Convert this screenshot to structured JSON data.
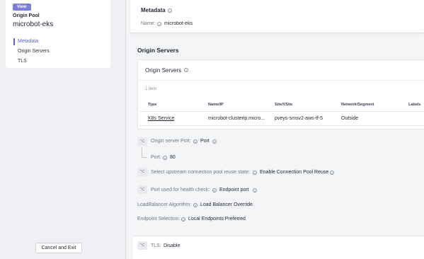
{
  "sidebar": {
    "badge": "View",
    "section_label": "Origin Pool",
    "pool_name": "microbot-eks",
    "items": [
      {
        "label": "Metadata",
        "active": true
      },
      {
        "label": "Origin Servers",
        "active": false
      },
      {
        "label": "TLS",
        "active": false
      }
    ],
    "cancel_label": "Cancel and Exit"
  },
  "metadata": {
    "title": "Metadata",
    "name_label": "Name:",
    "name_value": "microbot-eks"
  },
  "origin_servers": {
    "section_title": "Origin Servers",
    "card_title": "Origin Servers",
    "count": "1 item",
    "columns": [
      "Type",
      "Name/IP",
      "Site/VSite",
      "Network/Segment",
      "Labels"
    ],
    "rows": [
      [
        "K8s Service",
        "microbot-clusterip.micro...",
        "pveys-smsv2-aws-tf-5",
        "Outside",
        ""
      ]
    ]
  },
  "settings": {
    "origin_port_label": "Origin server Port:",
    "origin_port_value": "Port",
    "port_label": "Port:",
    "port_value": "80",
    "reuse_label": "Select upstream connection pool reuse state:",
    "reuse_value": "Enable Connection Pool Reuse",
    "health_label": "Port used for health check:",
    "health_value": "Endpoint port",
    "lb_label": "LoadBalancer Algorithm:",
    "lb_value": "Load Balancer Override",
    "endpoint_label": "Endpoint Selection:",
    "endpoint_value": "Local Endpoints Preferred",
    "tls_label": "TLS:",
    "tls_value": "Disable"
  },
  "icons": {
    "info": "info-icon",
    "toggle": "choice-icon"
  },
  "colors": {
    "accent": "#5963d1",
    "badge": "#7d7fd6"
  }
}
